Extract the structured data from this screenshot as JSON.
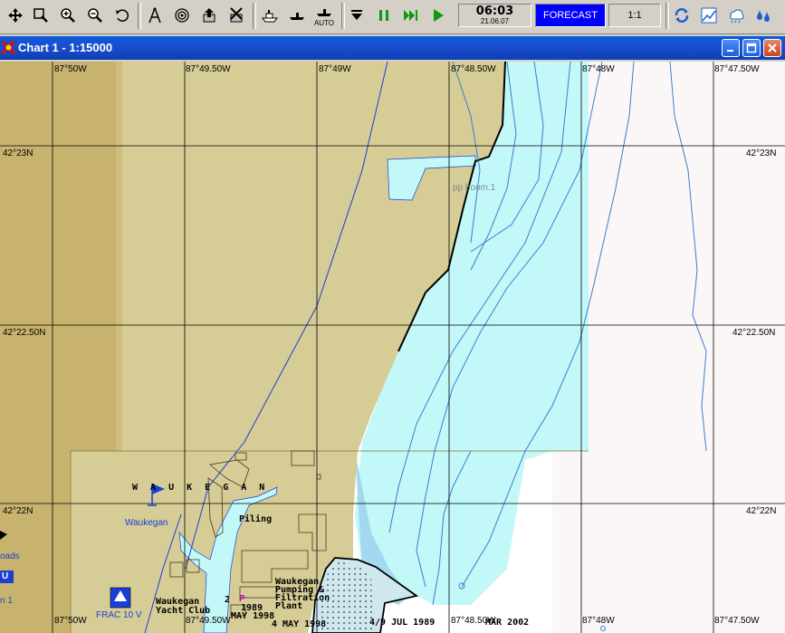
{
  "toolbar": {
    "time": "06:03",
    "date": "21.06.07",
    "forecast_label": "FORECAST",
    "scale": "1:1",
    "auto_label": "AUTO"
  },
  "window": {
    "title": "Chart 1 - 1:15000"
  },
  "map": {
    "lon_labels": [
      "87°50W",
      "87°49.50W",
      "87°49W",
      "87°48.50W",
      "87°48W",
      "87°47.50W"
    ],
    "lon_labels_bottom": [
      "87°50W",
      "87°49.50W",
      "87°48.50W",
      "87°48W",
      "87°47.50W"
    ],
    "lat_labels": [
      "42°23N",
      "42°22.50N",
      "42°22N"
    ],
    "place_waukegan_spaced": "W A U K E G A N",
    "place_waukegan": "Waukegan",
    "piling": "Piling",
    "boom": "pp boom.1",
    "yacht_club": "Waukegan Yacht Club",
    "pumping": "Waukegan Pumping & Filtration Plant",
    "frac": "FRAC 10 V",
    "roads": "oads",
    "n1": "n 1",
    "date_1998": "4 MAY 1998",
    "date_1989": "4/9 JUL 1989",
    "date_2002": "MAR 2002",
    "date_1989b": "1989",
    "date_1998b": "MAY 1998",
    "u_label": "U",
    "p_label": "P",
    "two_label": "2"
  },
  "colors": {
    "land": "#d6cc95",
    "land_dark": "#c7b36e",
    "shallow": "#c2f8f8",
    "medium": "#a4d8ee",
    "deep": "#ffffff",
    "depth_contour": "#3a7ecf",
    "grid": "#000000"
  }
}
